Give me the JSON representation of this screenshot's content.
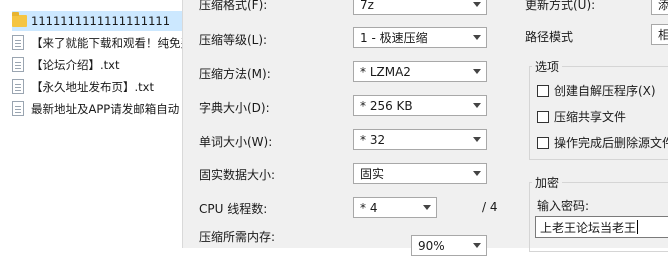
{
  "files": [
    {
      "name": "1111111111111111111",
      "type": "folder",
      "selected": true
    },
    {
      "name": "【来了就能下载和观看！纯免费",
      "type": "txt"
    },
    {
      "name": "【论坛介绍】.txt",
      "type": "txt"
    },
    {
      "name": "【永久地址发布页】.txt",
      "type": "txt"
    },
    {
      "name": "最新地址及APP请发邮箱自动",
      "type": "txt"
    }
  ],
  "left": {
    "format_label": "压缩格式(F):",
    "format_value": "7z",
    "level_label": "压缩等级(L):",
    "level_value": "1 - 极速压缩",
    "method_label": "压缩方法(M):",
    "method_value": "* LZMA2",
    "dict_label": "字典大小(D):",
    "dict_value": "* 256 KB",
    "word_label": "单词大小(W):",
    "word_value": "* 32",
    "solid_label": "固实数据大小:",
    "solid_value": "固实",
    "cpu_label": "CPU 线程数:",
    "cpu_value": "* 4",
    "cpu_total": "/ 4",
    "memory_label": "压缩所需内存:",
    "memory_value": "90%"
  },
  "right": {
    "update_label": "更新方式(U):",
    "update_value": "添加",
    "path_label": "路径模式",
    "path_value": "相对",
    "options_title": "选项",
    "options": [
      {
        "label": "创建自解压程序(X)",
        "checked": false
      },
      {
        "label": "压缩共享文件",
        "checked": false
      },
      {
        "label": "操作完成后删除源文件",
        "checked": false
      }
    ],
    "encrypt_title": "加密",
    "password_label": "输入密码:",
    "password_value": "上老王论坛当老王"
  }
}
